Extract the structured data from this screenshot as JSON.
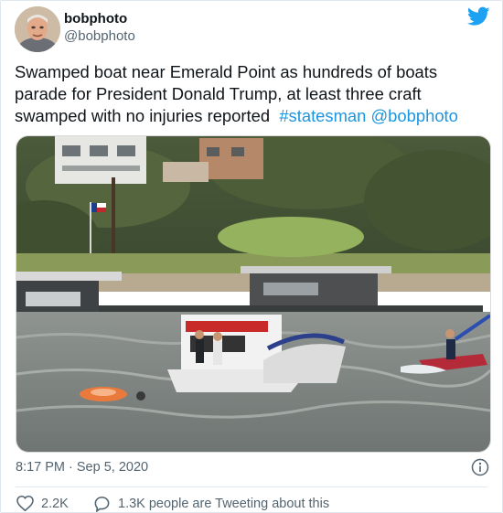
{
  "author": {
    "name": "bobphoto",
    "handle": "@bobphoto"
  },
  "tweet": {
    "text_main": "Swamped boat near Emerald Point as hundreds of boats parade for President Donald Trump, at least three craft swamped with no injuries reported",
    "hashtag": "#statesman",
    "mention": "@bobphoto"
  },
  "footer": {
    "timestamp": "8:17 PM · Sep 5, 2020",
    "like_count": "2.2K",
    "reply_text": "1.3K people are Tweeting about this"
  },
  "colors": {
    "link": "#1b95e0",
    "secondary_text": "#536471"
  },
  "icons": {
    "brand": "twitter-bird-icon",
    "info": "info-icon",
    "like": "heart-icon",
    "reply": "reply-bubble-icon"
  }
}
